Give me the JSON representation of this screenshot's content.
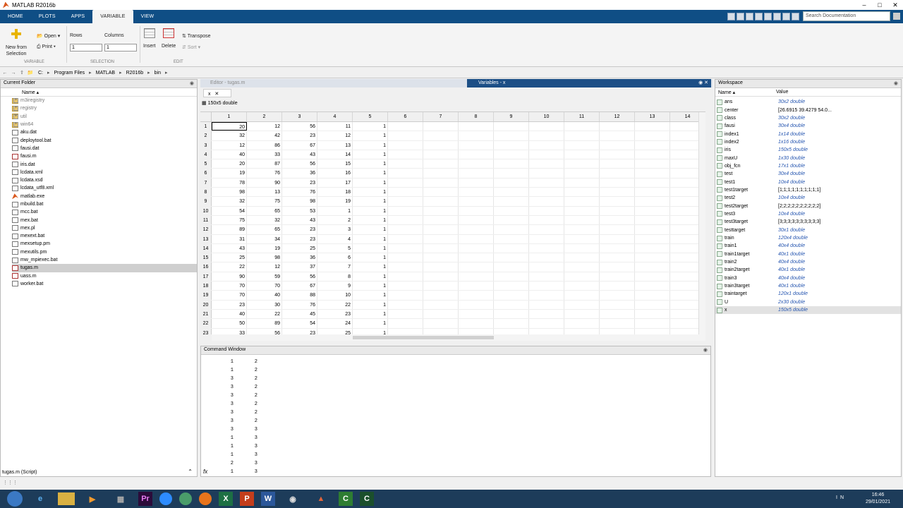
{
  "window": {
    "title": "MATLAB R2016b"
  },
  "tabs": [
    "HOME",
    "PLOTS",
    "APPS",
    "VARIABLE",
    "VIEW"
  ],
  "search": {
    "placeholder": "Search Documentation"
  },
  "ribbon": {
    "new_from_selection": "New from\nSelection",
    "open": "Open",
    "print": "Print",
    "rows_label": "Rows",
    "columns_label": "Columns",
    "rows_value": "1",
    "columns_value": "1",
    "insert": "Insert",
    "delete": "Delete",
    "transpose": "Transpose",
    "sort": "Sort",
    "section_variable": "VARIABLE",
    "section_selection": "SELECTION",
    "section_edit": "EDIT"
  },
  "path": [
    "C:",
    "Program Files",
    "MATLAB",
    "R2016b",
    "bin"
  ],
  "current_folder": {
    "title": "Current Folder",
    "col_name": "Name",
    "items": [
      {
        "name": "m3iregistry",
        "type": "dir"
      },
      {
        "name": "registry",
        "type": "dir"
      },
      {
        "name": "util",
        "type": "dir"
      },
      {
        "name": "win64",
        "type": "dir"
      },
      {
        "name": "aku.dat",
        "type": "file"
      },
      {
        "name": "deploytool.bat",
        "type": "file"
      },
      {
        "name": "fausi.dat",
        "type": "file"
      },
      {
        "name": "fausi.m",
        "type": "mfile"
      },
      {
        "name": "iris.dat",
        "type": "file"
      },
      {
        "name": "lcdata.xml",
        "type": "file"
      },
      {
        "name": "lcdata.xsd",
        "type": "file"
      },
      {
        "name": "lcdata_utf8.xml",
        "type": "file"
      },
      {
        "name": "matlab.exe",
        "type": "exe"
      },
      {
        "name": "mbuild.bat",
        "type": "file"
      },
      {
        "name": "mcc.bat",
        "type": "file"
      },
      {
        "name": "mex.bat",
        "type": "file"
      },
      {
        "name": "mex.pl",
        "type": "file"
      },
      {
        "name": "mexext.bat",
        "type": "file"
      },
      {
        "name": "mexsetup.pm",
        "type": "file"
      },
      {
        "name": "mexutils.pm",
        "type": "file"
      },
      {
        "name": "mw_mpiexec.bat",
        "type": "file"
      },
      {
        "name": "tugas.m",
        "type": "mfile",
        "selected": true
      },
      {
        "name": "uass.m",
        "type": "mfile"
      },
      {
        "name": "worker.bat",
        "type": "file"
      }
    ],
    "status": "tugas.m  (Script)"
  },
  "editor": {
    "tab": "Editor - tugas.m"
  },
  "variables": {
    "title": "Variables - x",
    "tab": "x",
    "description": "150x5 double",
    "col_headers": [
      "1",
      "2",
      "3",
      "4",
      "5",
      "6",
      "7",
      "8",
      "9",
      "10",
      "11",
      "12",
      "13",
      "14"
    ],
    "rows": [
      [
        20,
        12,
        56,
        11,
        1
      ],
      [
        32,
        42,
        23,
        12,
        1
      ],
      [
        12,
        86,
        67,
        13,
        1
      ],
      [
        40,
        33,
        43,
        14,
        1
      ],
      [
        20,
        87,
        56,
        15,
        1
      ],
      [
        19,
        76,
        36,
        16,
        1
      ],
      [
        78,
        90,
        23,
        17,
        1
      ],
      [
        98,
        13,
        76,
        18,
        1
      ],
      [
        32,
        75,
        98,
        19,
        1
      ],
      [
        54,
        65,
        53,
        1,
        1
      ],
      [
        75,
        32,
        43,
        2,
        1
      ],
      [
        89,
        65,
        23,
        3,
        1
      ],
      [
        31,
        34,
        23,
        4,
        1
      ],
      [
        43,
        19,
        25,
        5,
        1
      ],
      [
        25,
        98,
        36,
        6,
        1
      ],
      [
        22,
        12,
        37,
        7,
        1
      ],
      [
        90,
        59,
        56,
        8,
        1
      ],
      [
        70,
        70,
        67,
        9,
        1
      ],
      [
        70,
        40,
        88,
        10,
        1
      ],
      [
        23,
        30,
        76,
        22,
        1
      ],
      [
        40,
        22,
        45,
        23,
        1
      ],
      [
        50,
        89,
        54,
        24,
        1
      ],
      [
        33,
        56,
        23,
        25,
        1
      ]
    ]
  },
  "command_window": {
    "title": "Command Window",
    "rows": [
      [
        1,
        2
      ],
      [
        1,
        2
      ],
      [
        3,
        2
      ],
      [
        3,
        2
      ],
      [
        3,
        2
      ],
      [
        3,
        2
      ],
      [
        3,
        2
      ],
      [
        3,
        2
      ],
      [
        3,
        3
      ],
      [
        1,
        3
      ],
      [
        1,
        3
      ],
      [
        1,
        3
      ],
      [
        2,
        3
      ],
      [
        1,
        3
      ]
    ],
    "prompt": "fx"
  },
  "workspace": {
    "title": "Workspace",
    "col_name": "Name",
    "col_value": "Value",
    "vars": [
      {
        "name": "ans",
        "value": "30x2 double",
        "italic": true
      },
      {
        "name": "center",
        "value": "[26.6915 39.4279 54.0...",
        "italic": false
      },
      {
        "name": "class",
        "value": "30x2 double",
        "italic": true
      },
      {
        "name": "fausi",
        "value": "30x4 double",
        "italic": true
      },
      {
        "name": "index1",
        "value": "1x14 double",
        "italic": true
      },
      {
        "name": "index2",
        "value": "1x16 double",
        "italic": true
      },
      {
        "name": "iris",
        "value": "150x5 double",
        "italic": true
      },
      {
        "name": "maxU",
        "value": "1x30 double",
        "italic": true
      },
      {
        "name": "obj_fcn",
        "value": "17x1 double",
        "italic": true
      },
      {
        "name": "test",
        "value": "30x4 double",
        "italic": true
      },
      {
        "name": "test1",
        "value": "10x4 double",
        "italic": true
      },
      {
        "name": "test1target",
        "value": "[1;1;1;1;1;1;1;1;1;1]",
        "italic": false
      },
      {
        "name": "test2",
        "value": "10x4 double",
        "italic": true
      },
      {
        "name": "test2target",
        "value": "[2;2;2;2;2;2;2;2;2;2]",
        "italic": false
      },
      {
        "name": "test3",
        "value": "10x4 double",
        "italic": true
      },
      {
        "name": "test3target",
        "value": "[3;3;3;3;3;3;3;3;3;3]",
        "italic": false
      },
      {
        "name": "testtarget",
        "value": "30x1 double",
        "italic": true
      },
      {
        "name": "train",
        "value": "120x4 double",
        "italic": true
      },
      {
        "name": "train1",
        "value": "40x4 double",
        "italic": true
      },
      {
        "name": "train1target",
        "value": "40x1 double",
        "italic": true
      },
      {
        "name": "train2",
        "value": "40x4 double",
        "italic": true
      },
      {
        "name": "train2target",
        "value": "40x1 double",
        "italic": true
      },
      {
        "name": "train3",
        "value": "40x4 double",
        "italic": true
      },
      {
        "name": "train3target",
        "value": "40x1 double",
        "italic": true
      },
      {
        "name": "traintarget",
        "value": "120x1 double",
        "italic": true
      },
      {
        "name": "U",
        "value": "2x30 double",
        "italic": true
      },
      {
        "name": "x",
        "value": "150x5 double",
        "italic": true
      }
    ]
  },
  "taskbar": {
    "time": "16:46",
    "date": "29/01/2021",
    "lang": "IN"
  }
}
